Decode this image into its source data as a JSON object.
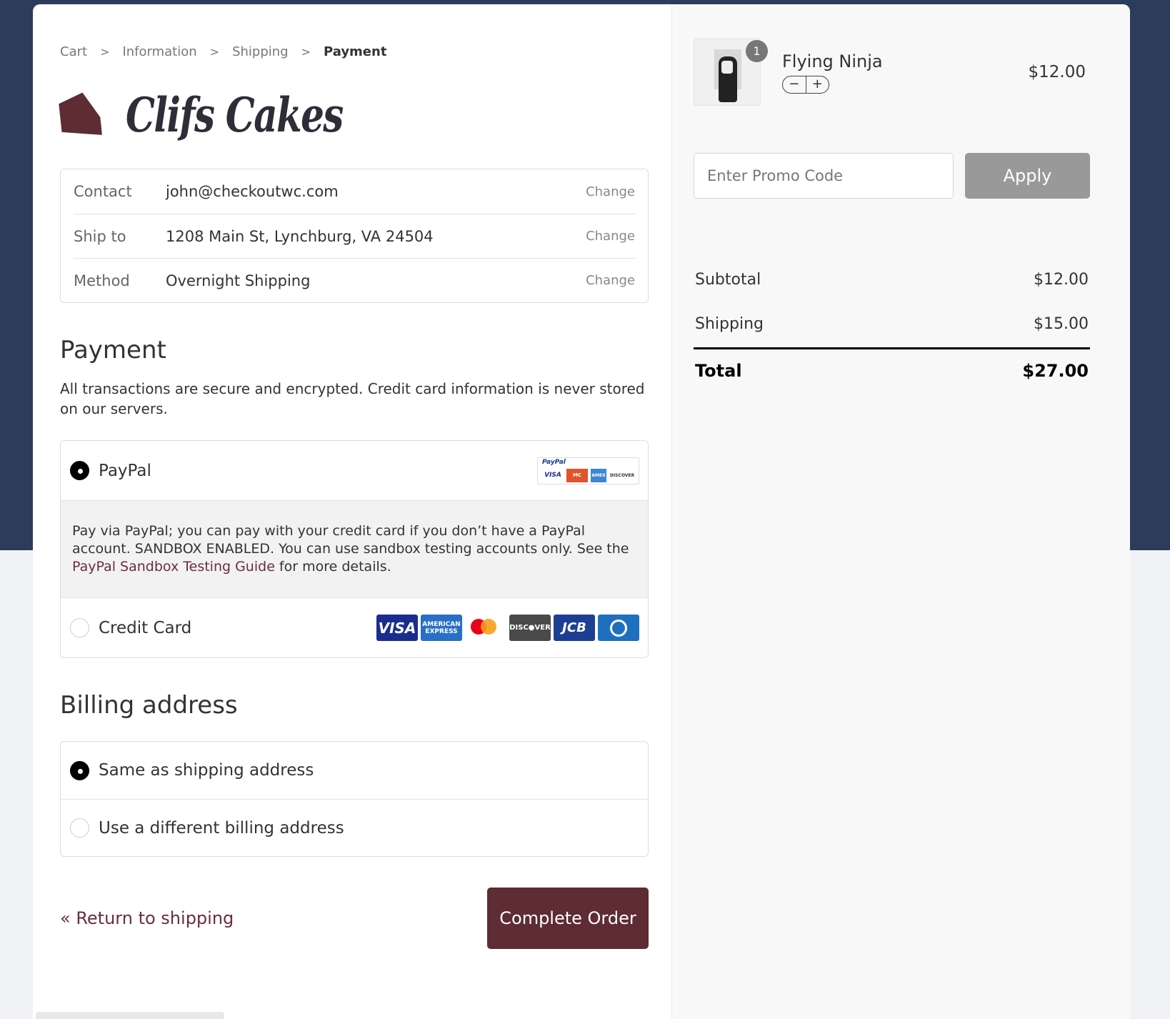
{
  "breadcrumb": {
    "items": [
      "Cart",
      "Information",
      "Shipping",
      "Payment"
    ],
    "separator": ">"
  },
  "brand": {
    "name": "Clifs Cakes",
    "color": "#5e2c33"
  },
  "review": {
    "contact": {
      "label": "Contact",
      "value": "john@checkoutwc.com",
      "action": "Change"
    },
    "ship_to": {
      "label": "Ship to",
      "value": "1208 Main St, Lynchburg, VA 24504",
      "action": "Change"
    },
    "method": {
      "label": "Method",
      "value": "Overnight Shipping",
      "action": "Change"
    }
  },
  "payment": {
    "heading": "Payment",
    "note": "All transactions are secure and encrypted. Credit card information is never stored on our servers.",
    "paypal": {
      "label": "PayPal",
      "selected": true,
      "logo_text": "PayPal",
      "card_marks": [
        "VISA",
        "MC",
        "AMEX",
        "DISCOVER"
      ],
      "desc_before": "Pay via PayPal; you can pay with your credit card if you don’t have a PayPal account. SANDBOX ENABLED. You can use sandbox testing accounts only. See the ",
      "desc_link": "PayPal Sandbox Testing Guide",
      "desc_after": " for more details."
    },
    "credit_card": {
      "label": "Credit Card",
      "selected": false,
      "logos": {
        "visa": "VISA",
        "amex": "AMERICAN EXPRESS",
        "mc": "mastercard",
        "discover": "DISC●VER",
        "jcb": "JCB"
      }
    }
  },
  "billing": {
    "heading": "Billing address",
    "options": [
      {
        "label": "Same as shipping address",
        "selected": true
      },
      {
        "label": "Use a different billing address",
        "selected": false
      }
    ]
  },
  "actions": {
    "return_label": "« Return to shipping",
    "complete_label": "Complete Order"
  },
  "cart": {
    "item": {
      "name": "Flying Ninja",
      "quantity": "1",
      "price": "$12.00",
      "minus": "−",
      "plus": "+"
    },
    "promo": {
      "placeholder": "Enter Promo Code",
      "apply_label": "Apply"
    },
    "totals": {
      "subtotal_label": "Subtotal",
      "subtotal": "$12.00",
      "shipping_label": "Shipping",
      "shipping": "$15.00",
      "total_label": "Total",
      "total": "$27.00"
    }
  },
  "colors": {
    "page_bg": "#2c3d5b",
    "accent": "#5e2c33",
    "apply_disabled": "#999999"
  }
}
